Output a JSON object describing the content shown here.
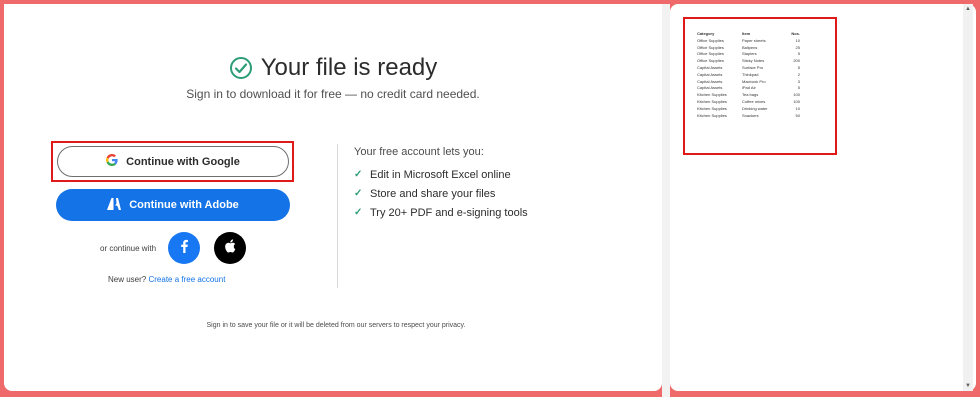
{
  "header": {
    "title": "Your file is ready",
    "subtitle": "Sign in to download it for free — no credit card needed."
  },
  "auth": {
    "google_label": "Continue with Google",
    "adobe_label": "Continue with Adobe",
    "or_text": "or continue with",
    "new_user_text": "New user?",
    "create_account_link": "Create a free account"
  },
  "benefits": {
    "title": "Your free account lets you:",
    "items": [
      "Edit in Microsoft Excel online",
      "Store and share your files",
      "Try 20+ PDF and e-signing tools"
    ]
  },
  "footer": {
    "privacy_text": "Sign in to save your file or it will be deleted from our servers to respect your privacy."
  },
  "preview": {
    "columns": [
      "Category",
      "Item",
      "Nos."
    ],
    "rows": [
      [
        "Office Supplies",
        "Paper sheets",
        "10"
      ],
      [
        "Office Supplies",
        "Ballpens",
        "25"
      ],
      [
        "Office Supplies",
        "Staplers",
        "5"
      ],
      [
        "Office Supplies",
        "Sticky Notes",
        "200"
      ],
      [
        "Capital Assets",
        "Surface Pro",
        "5"
      ],
      [
        "Capital Assets",
        "Thinkpad",
        "2"
      ],
      [
        "Capital Assets",
        "Macbook Pro",
        "3"
      ],
      [
        "Capital Assets",
        "iPad Air",
        "5"
      ],
      [
        "Kitchen Supplies",
        "Tea bags",
        "100"
      ],
      [
        "Kitchen Supplies",
        "Coffee mixes",
        "100"
      ],
      [
        "Kitchen Supplies",
        "Drinking water",
        "10"
      ],
      [
        "Kitchen Supplies",
        "Snackers",
        "50"
      ]
    ]
  },
  "icons": {
    "check": "check-circle-icon",
    "google": "google-icon",
    "adobe": "adobe-icon",
    "facebook": "facebook-icon",
    "apple": "apple-icon"
  },
  "colors": {
    "accent_blue": "#1473e6",
    "success_green": "#2d9d78",
    "highlight_red": "#e0191b",
    "background_coral": "#ef6b6b"
  }
}
